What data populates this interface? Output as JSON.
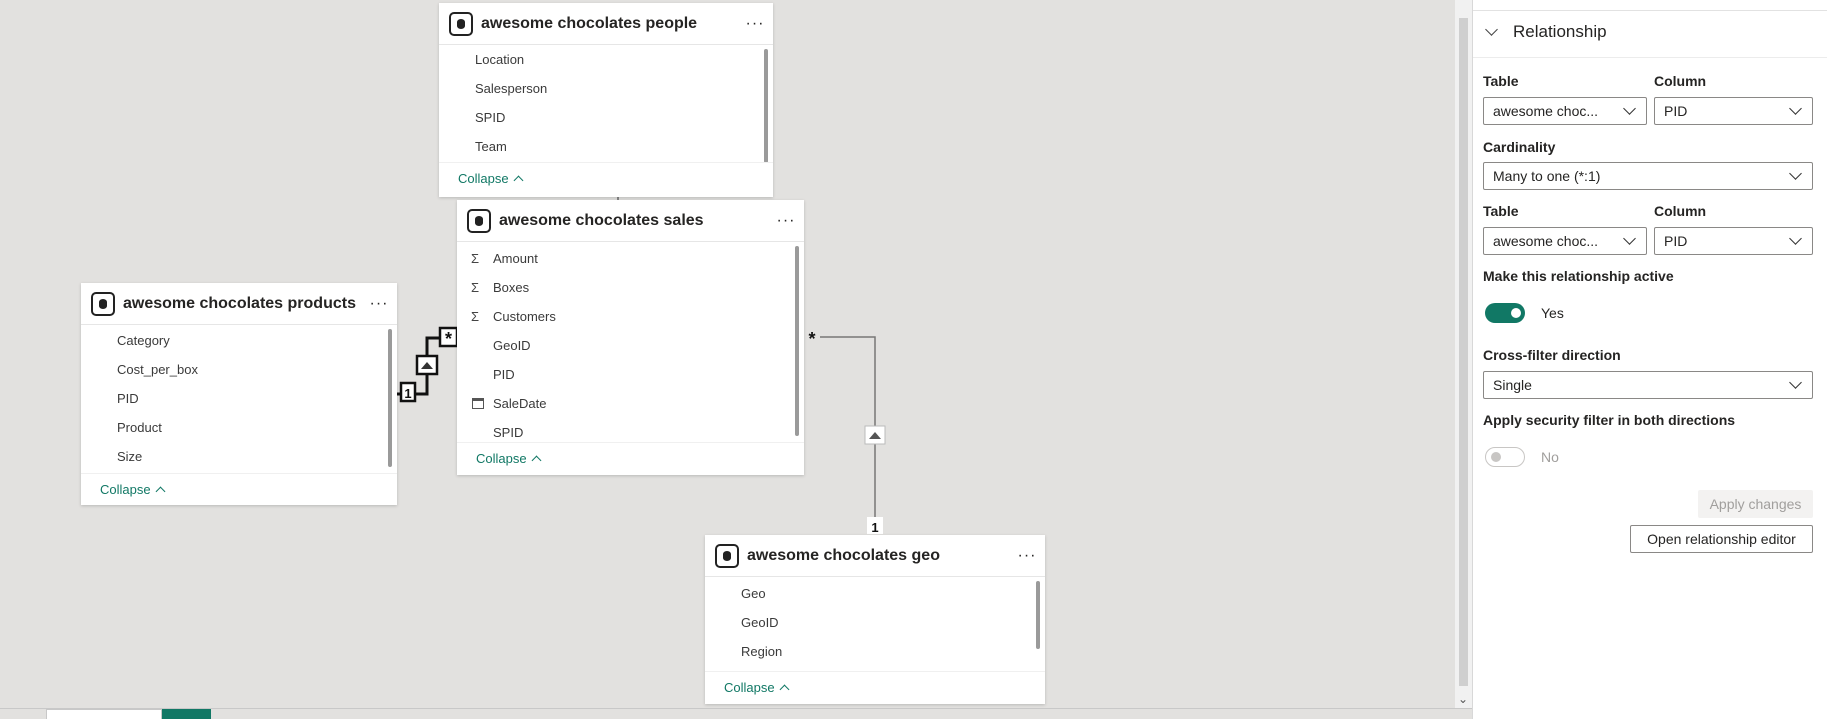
{
  "tables": {
    "people": {
      "name": "awesome chocolates people",
      "fields": [
        "Location",
        "Salesperson",
        "SPID",
        "Team"
      ],
      "collapse": "Collapse"
    },
    "sales": {
      "name": "awesome chocolates sales",
      "fields": [
        {
          "label": "Amount",
          "icon": "sigma-icon"
        },
        {
          "label": "Boxes",
          "icon": "sigma-icon"
        },
        {
          "label": "Customers",
          "icon": "sigma-icon"
        },
        {
          "label": "GeoID",
          "icon": ""
        },
        {
          "label": "PID",
          "icon": ""
        },
        {
          "label": "SaleDate",
          "icon": "calendar-icon"
        },
        {
          "label": "SPID",
          "icon": ""
        }
      ],
      "collapse": "Collapse"
    },
    "products": {
      "name": "awesome chocolates products",
      "fields": [
        "Category",
        "Cost_per_box",
        "PID",
        "Product",
        "Size"
      ],
      "collapse": "Collapse"
    },
    "geo": {
      "name": "awesome chocolates geo",
      "fields": [
        "Geo",
        "GeoID",
        "Region"
      ],
      "collapse": "Collapse"
    }
  },
  "relationships": {
    "products_sales": {
      "one": "1",
      "many": "*"
    },
    "sales_geo": {
      "one": "1",
      "many": "*"
    }
  },
  "more_glyph": "···",
  "panel": {
    "section_title": "Relationship",
    "table_label": "Table",
    "column_label": "Column",
    "table1_value": "awesome choc...",
    "column1_value": "PID",
    "cardinality_label": "Cardinality",
    "cardinality_value": "Many to one (*:1)",
    "table2_value": "awesome choc...",
    "column2_value": "PID",
    "active_label": "Make this relationship active",
    "active_value": "Yes",
    "crossfilter_label": "Cross-filter direction",
    "crossfilter_value": "Single",
    "security_label": "Apply security filter in both directions",
    "security_value": "No",
    "apply_button": "Apply changes",
    "open_editor_button": "Open relationship editor"
  },
  "colors": {
    "accent": "#117865",
    "canvas": "#e2e1df"
  }
}
